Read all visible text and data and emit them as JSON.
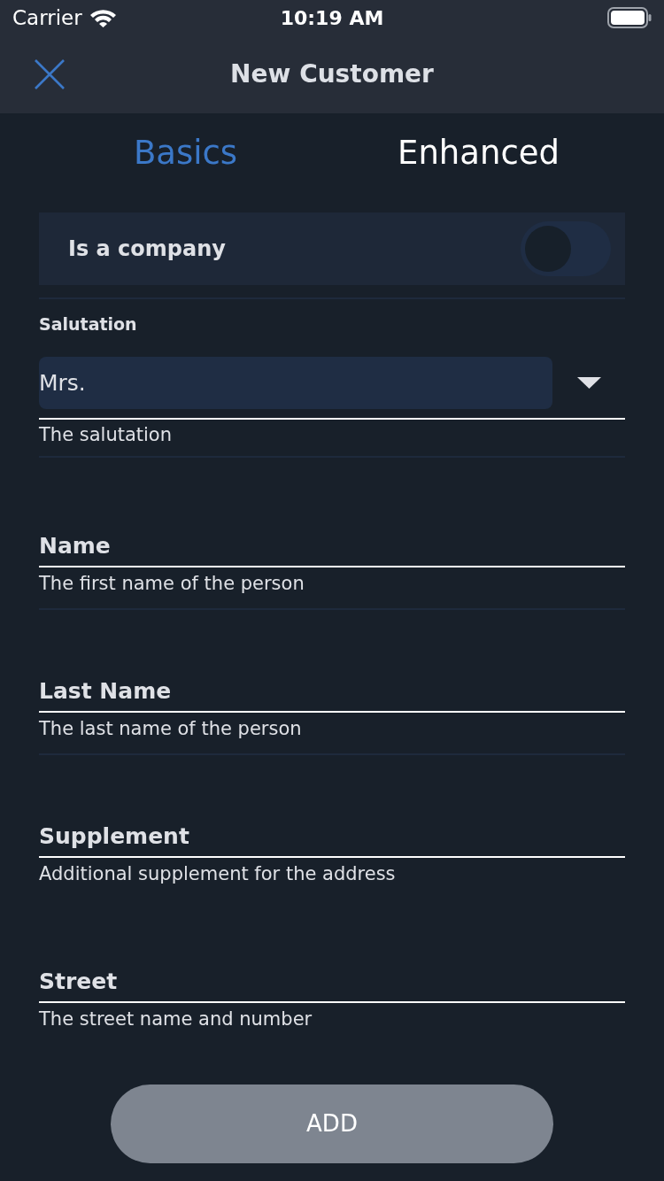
{
  "status_bar": {
    "carrier": "Carrier",
    "time": "10:19 AM"
  },
  "nav": {
    "title": "New Customer"
  },
  "tabs": [
    {
      "label": "Basics",
      "selected": true
    },
    {
      "label": "Enhanced",
      "selected": false
    }
  ],
  "company_toggle": {
    "label": "Is a company",
    "on": false
  },
  "salutation": {
    "label": "Salutation",
    "value": "Mrs.",
    "hint": "The salutation"
  },
  "fields": [
    {
      "placeholder": "Name",
      "hint": "The first name of the person",
      "divider": true
    },
    {
      "placeholder": "Last Name",
      "hint": "The last name of the person",
      "divider": true
    },
    {
      "placeholder": "Supplement",
      "hint": "Additional supplement for the address",
      "divider": false
    },
    {
      "placeholder": "Street",
      "hint": "The street name and number",
      "divider": false
    }
  ],
  "add_button": {
    "label": "ADD",
    "disabled": true
  }
}
